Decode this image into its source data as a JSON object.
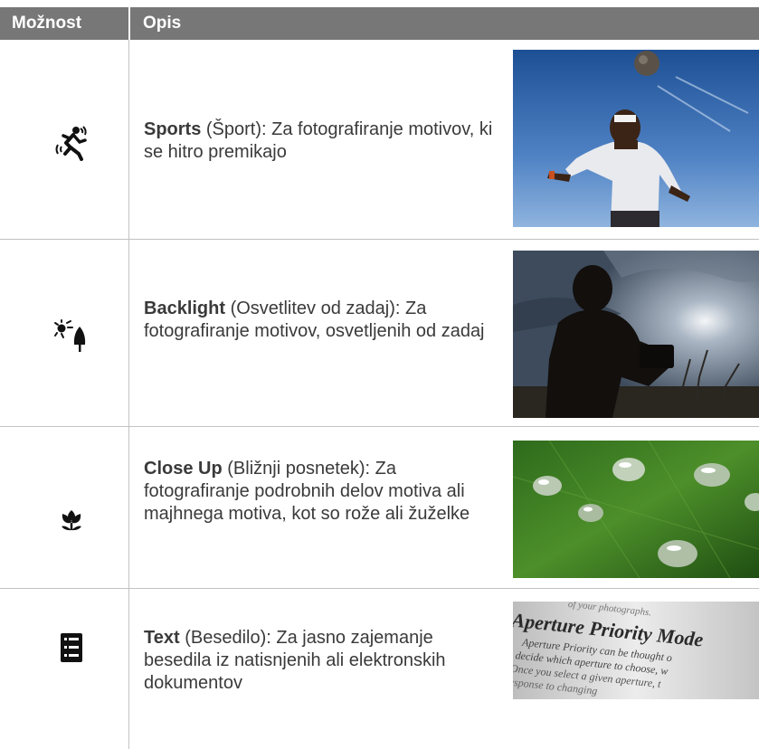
{
  "header": {
    "option_label": "Možnost",
    "description_label": "Opis"
  },
  "rows": [
    {
      "icon": "sports-runner-icon",
      "name": "Sports",
      "detail": " (Šport): Za fotografiranje motivov, ki se hitro premikajo"
    },
    {
      "icon": "backlight-sun-tree-icon",
      "name": "Backlight",
      "detail": " (Osvetlitev od zadaj): Za fotografiranje motivov, osvetljenih od zadaj"
    },
    {
      "icon": "flower-macro-icon",
      "name": "Close Up",
      "detail": " (Bližnji posnetek): Za fotografiranje podrobnih delov motiva ali majhnega motiva, kot so rože ali žuželke"
    },
    {
      "icon": "document-text-icon",
      "name": "Text",
      "detail": " (Besedilo): Za jasno zajemanje besedila iz natisnjenih ali elektronskih dokumentov"
    }
  ],
  "text_photo": {
    "top_line": "of your photographs.",
    "heading": "Aperture Priority Mode",
    "lines": [
      "Aperture Priority can be thought o",
      "decide which aperture to choose, w",
      "Once you select a given aperture, t",
      "response to changing"
    ]
  }
}
